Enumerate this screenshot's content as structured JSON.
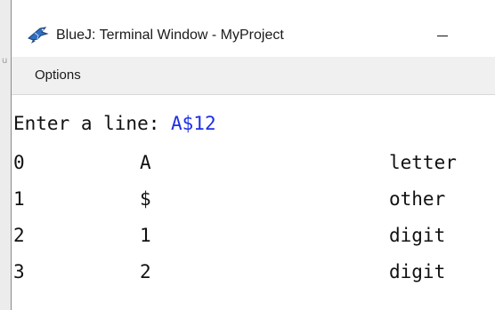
{
  "window": {
    "title": "BlueJ: Terminal Window - MyProject",
    "app_icon": "bluej-bird-icon",
    "minimize_icon": "minimize-icon"
  },
  "menu": {
    "options_label": "Options"
  },
  "terminal": {
    "prompt": "Enter a line: ",
    "user_input": "A$12",
    "input_color": "#1e2ee8",
    "rows": [
      {
        "index": "0",
        "char": "A",
        "type": "letter"
      },
      {
        "index": "1",
        "char": "$",
        "type": "other"
      },
      {
        "index": "2",
        "char": "1",
        "type": "digit"
      },
      {
        "index": "3",
        "char": "2",
        "type": "digit"
      }
    ]
  }
}
